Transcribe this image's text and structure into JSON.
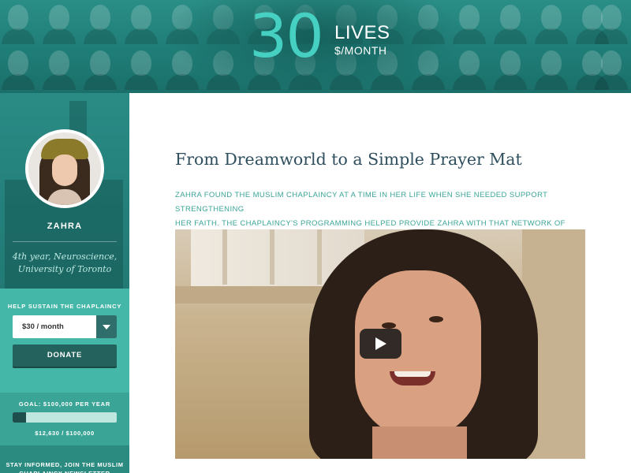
{
  "header": {
    "logo_number": "30",
    "logo_lives": "LIVES",
    "logo_unit": "$/MONTH"
  },
  "profile": {
    "name": "ZAHRA",
    "info_line1": "4th year, Neuroscience,",
    "info_line2": "University of Toronto"
  },
  "donate": {
    "heading": "HELP SUSTAIN THE CHAPLAINCY",
    "selected_amount": "$30 / month",
    "button_label": "DONATE"
  },
  "goal": {
    "label": "GOAL: $100,000 PER YEAR",
    "progress_text": "$12,630 / $100,000",
    "raised": 12630,
    "target": 100000
  },
  "newsletter": {
    "text": "STAY INFORMED, JOIN THE MUSLIM CHAPLAINCY NEWSLETTER"
  },
  "article": {
    "title": "From Dreamworld to a Simple Prayer Mat",
    "intro_line1": "ZAHRA FOUND THE MUSLIM CHAPLAINCY AT A TIME IN HER LIFE WHEN SHE NEEDED SUPPORT STRENGTHENING",
    "intro_line2": "HER FAITH. THE CHAPLAINCY'S PROGRAMMING HELPED PROVIDE ZAHRA WITH THAT NETWORK OF SUPPORT."
  },
  "colors": {
    "teal_dark": "#237a75",
    "teal_light": "#45b7a8",
    "logo_accent": "#45d0c1",
    "title_text": "#2f4f5e"
  }
}
